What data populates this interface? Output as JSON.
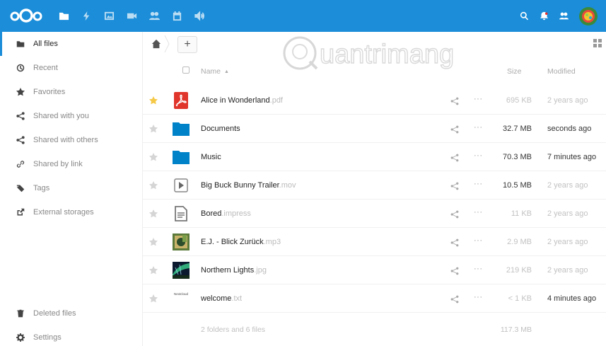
{
  "header": {
    "apps": [
      {
        "icon": "folder-icon",
        "active": true
      },
      {
        "icon": "activity-icon",
        "active": false
      },
      {
        "icon": "gallery-icon",
        "active": false
      },
      {
        "icon": "video-icon",
        "active": false
      },
      {
        "icon": "contacts-icon",
        "active": false
      },
      {
        "icon": "calendar-icon",
        "active": false
      },
      {
        "icon": "audio-icon",
        "active": false
      }
    ],
    "right_icons": [
      "search-icon",
      "notifications-icon",
      "contacts-menu-icon"
    ]
  },
  "sidebar": {
    "items": [
      {
        "label": "All files",
        "icon": "folder-icon",
        "active": true
      },
      {
        "label": "Recent",
        "icon": "clock-icon"
      },
      {
        "label": "Favorites",
        "icon": "star-icon"
      },
      {
        "label": "Shared with you",
        "icon": "share-icon"
      },
      {
        "label": "Shared with others",
        "icon": "share-icon"
      },
      {
        "label": "Shared by link",
        "icon": "link-icon"
      },
      {
        "label": "Tags",
        "icon": "tag-icon"
      },
      {
        "label": "External storages",
        "icon": "external-icon"
      }
    ],
    "bottom": [
      {
        "label": "Deleted files",
        "icon": "trash-icon"
      },
      {
        "label": "Settings",
        "icon": "gear-icon"
      }
    ]
  },
  "breadcrumb": {
    "add_label": "+"
  },
  "watermark": {
    "text": "uantrimang"
  },
  "table": {
    "columns": {
      "name": "Name",
      "sort_arrow": "▲",
      "size": "Size",
      "modified": "Modified"
    },
    "rows": [
      {
        "name": "Alice in Wonderland",
        "ext": ".pdf",
        "type": "pdf",
        "size": "695 KB",
        "modified": "2 years ago",
        "favorite": true,
        "size_dark": false,
        "mod_dark": false
      },
      {
        "name": "Documents",
        "ext": "",
        "type": "folder",
        "size": "32.7 MB",
        "modified": "seconds ago",
        "favorite": false,
        "size_dark": true,
        "mod_dark": true
      },
      {
        "name": "Music",
        "ext": "",
        "type": "folder",
        "size": "70.3 MB",
        "modified": "7 minutes ago",
        "favorite": false,
        "size_dark": true,
        "mod_dark": true
      },
      {
        "name": "Big Buck Bunny Trailer",
        "ext": ".mov",
        "type": "video",
        "size": "10.5 MB",
        "modified": "2 years ago",
        "favorite": false,
        "size_dark": true,
        "mod_dark": false
      },
      {
        "name": "Bored",
        "ext": ".impress",
        "type": "doc",
        "size": "11 KB",
        "modified": "2 years ago",
        "favorite": false,
        "size_dark": false,
        "mod_dark": false
      },
      {
        "name": "E.J. - Blick Zurück",
        "ext": ".mp3",
        "type": "audio",
        "size": "2.9 MB",
        "modified": "2 years ago",
        "favorite": false,
        "size_dark": false,
        "mod_dark": false
      },
      {
        "name": "Northern Lights",
        "ext": ".jpg",
        "type": "image",
        "size": "219 KB",
        "modified": "2 years ago",
        "favorite": false,
        "size_dark": false,
        "mod_dark": false
      },
      {
        "name": "welcome",
        "ext": ".txt",
        "type": "text",
        "size": "< 1 KB",
        "modified": "4 minutes ago",
        "favorite": false,
        "size_dark": false,
        "mod_dark": true
      }
    ],
    "thumb_text": "Nextcloud",
    "summary": {
      "count": "2 folders and 6 files",
      "size": "117.3 MB"
    }
  },
  "colors": {
    "header_bg": "#1b8dd9",
    "folder": "#0082c9",
    "pdf": "#e0352b",
    "star_fav": "#f5c947",
    "star_off": "#d5d5d5"
  }
}
